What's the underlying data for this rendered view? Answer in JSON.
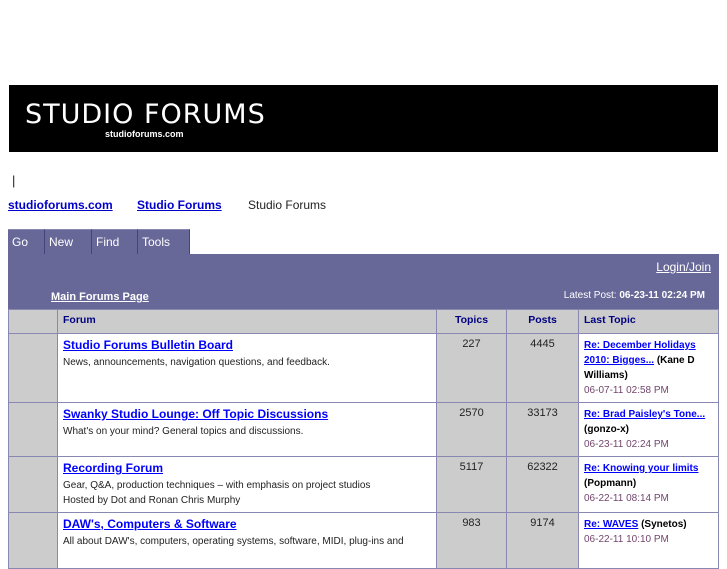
{
  "banner": {
    "logo": "STUDIO FORUMS",
    "sub": "studioforums.com"
  },
  "pipe": "|",
  "breadcrumb": [
    "studioforums.com",
    "Studio Forums",
    "Studio Forums"
  ],
  "tabs": [
    "Go",
    "New",
    "Find",
    "Tools"
  ],
  "header": {
    "login": "Login/Join",
    "main_page": "Main Forums Page",
    "latest_label": "Latest Post:",
    "latest_value": "06-23-11 02:24 PM"
  },
  "columns": [
    "Forum",
    "Topics",
    "Posts",
    "Last Topic"
  ],
  "forums": [
    {
      "title": "Studio Forums Bulletin Board",
      "desc": "News, announcements, navigation questions, and feedback.",
      "desc2": "",
      "topics": "227",
      "posts": "4445",
      "last_topic": "Re: December Holidays 2010: Bigges...",
      "last_user": "(Kane D Williams)",
      "last_date": "06-07-11 02:58 PM"
    },
    {
      "title": "Swanky Studio Lounge: Off Topic Discussions",
      "desc": "What's on your mind? General topics and discussions.",
      "desc2": "",
      "topics": "2570",
      "posts": "33173",
      "last_topic": "Re: Brad Paisley's Tone...",
      "last_user": "(gonzo-x)",
      "last_date": "06-23-11 02:24 PM"
    },
    {
      "title": "Recording Forum",
      "desc": "Gear, Q&A, production techniques – with emphasis on project studios",
      "desc2": "Hosted by Dot and Ronan Chris Murphy",
      "topics": "5117",
      "posts": "62322",
      "last_topic": "Re: Knowing your limits",
      "last_user": "(Popmann)",
      "last_date": "06-22-11 08:14 PM"
    },
    {
      "title": "DAW's, Computers & Software",
      "desc": "All about DAW's, computers, operating systems, software, MIDI, plug-ins and",
      "desc2": "",
      "topics": "983",
      "posts": "9174",
      "last_topic": "Re: WAVES",
      "last_user": "(Synetos)",
      "last_date": "06-22-11 10:10 PM"
    }
  ]
}
